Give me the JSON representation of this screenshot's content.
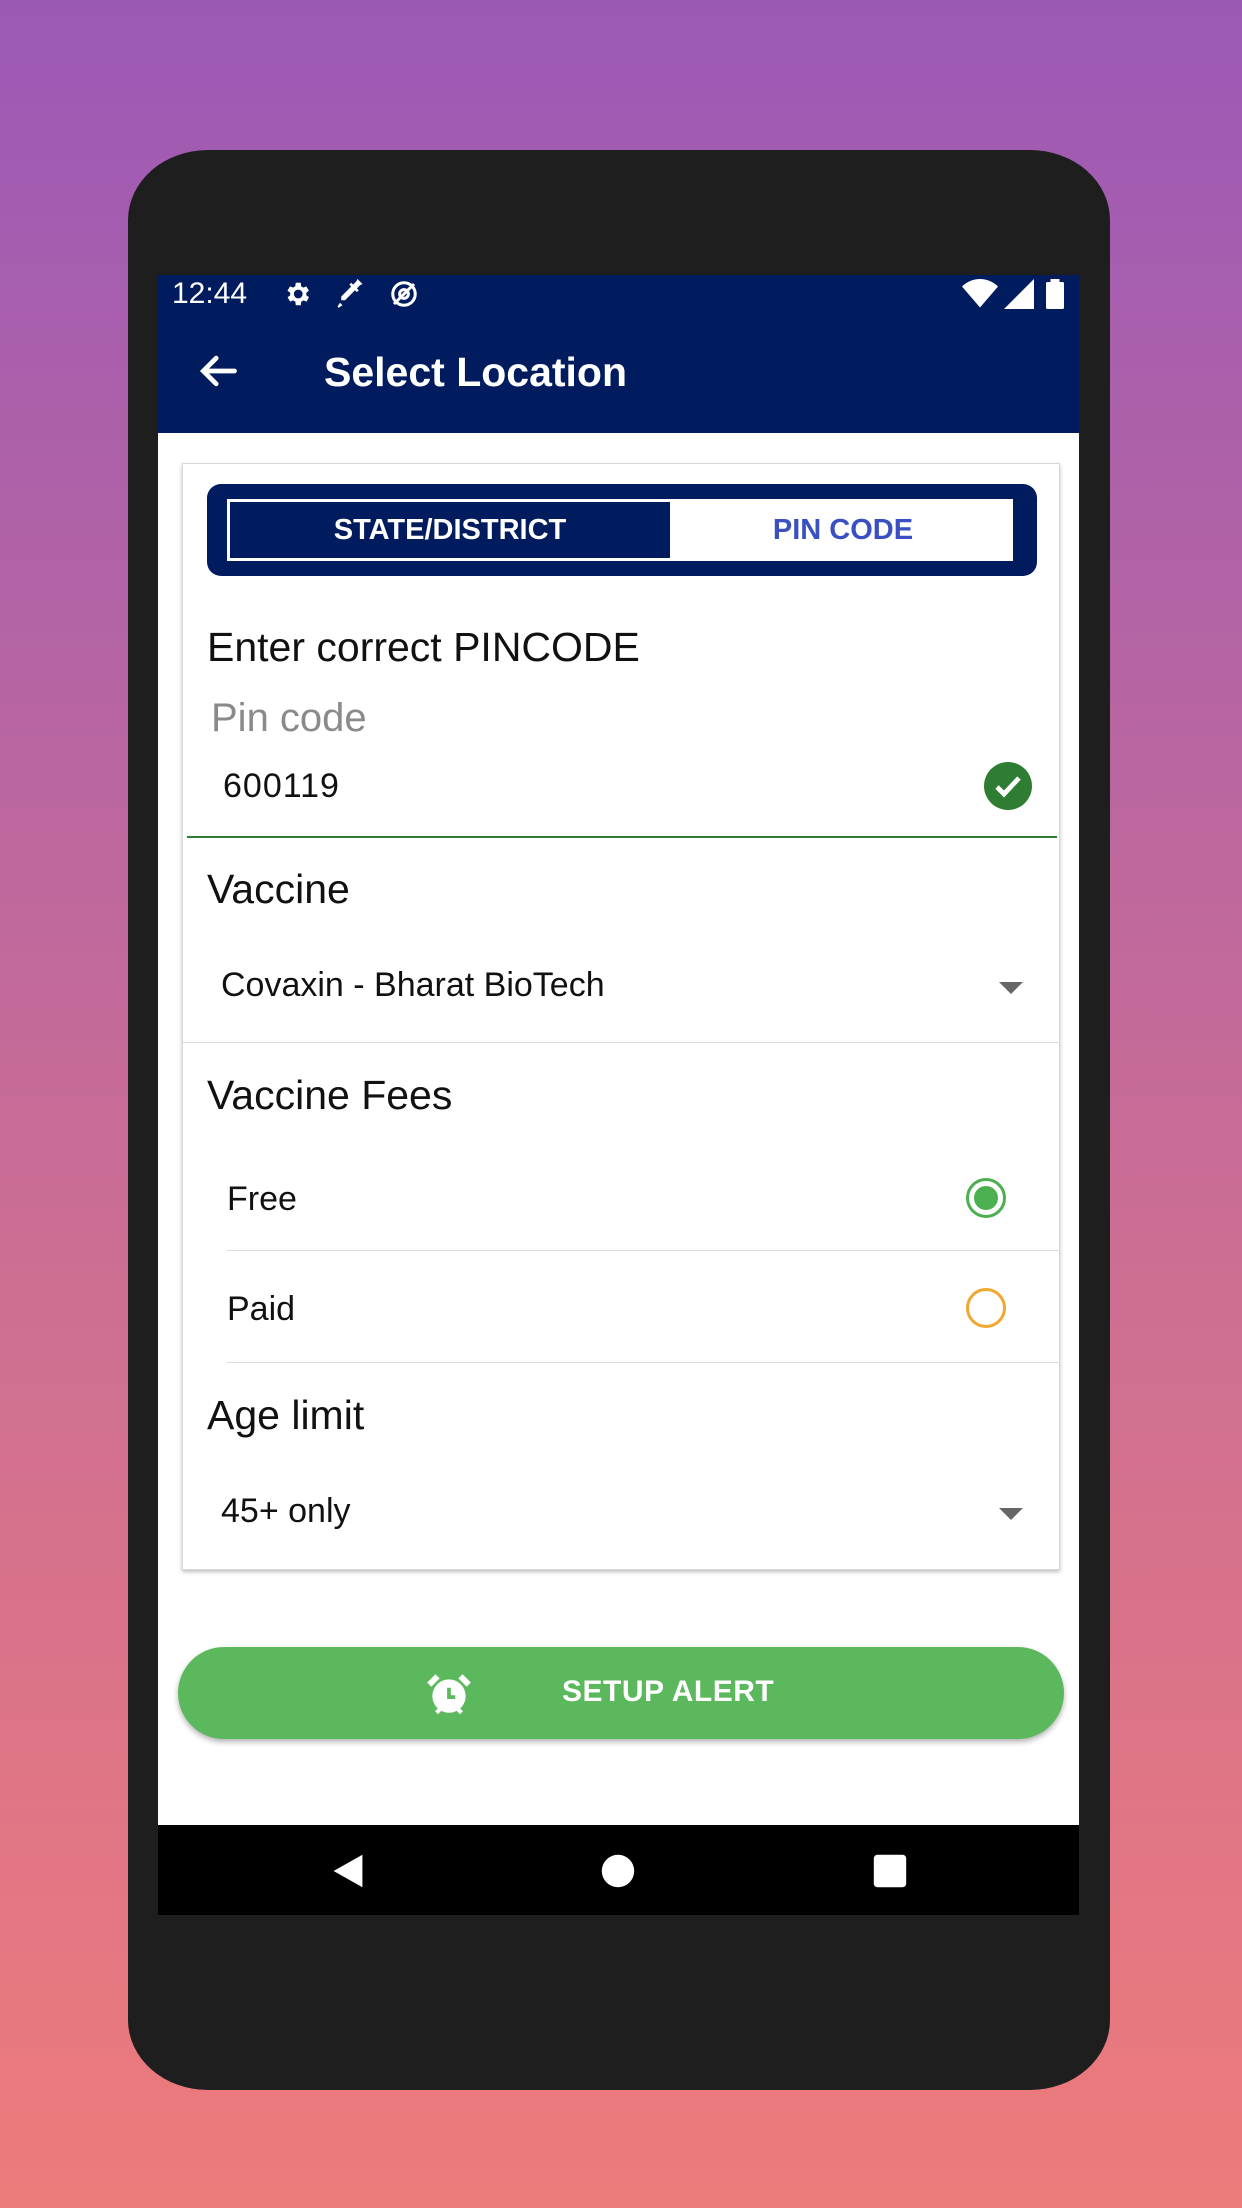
{
  "status_bar": {
    "time": "12:44",
    "icons": [
      "gear-icon",
      "syringe-icon",
      "vpn-icon",
      "wifi-icon",
      "signal-icon",
      "battery-icon"
    ]
  },
  "app_bar": {
    "title": "Select Location",
    "back_icon": "arrow-left-icon",
    "background": "#011c5e"
  },
  "tabs": [
    {
      "label": "STATE/DISTRICT",
      "selected": false
    },
    {
      "label": "PIN CODE",
      "selected": true
    }
  ],
  "pincode": {
    "heading": "Enter correct PINCODE",
    "placeholder": "Pin code",
    "value": "600119",
    "valid": true
  },
  "vaccine": {
    "heading": "Vaccine",
    "selected": "Covaxin - Bharat BioTech"
  },
  "fees": {
    "heading": "Vaccine Fees",
    "options": [
      {
        "label": "Free",
        "selected": true
      },
      {
        "label": "Paid",
        "selected": false
      }
    ]
  },
  "age": {
    "heading": "Age limit",
    "selected": "45+ only"
  },
  "setup_alert": {
    "label": "SETUP ALERT",
    "icon": "alarm-clock-icon",
    "color": "#5cb85c"
  },
  "nav_bar": {
    "icons": [
      "back-triangle-icon",
      "home-circle-icon",
      "recents-square-icon"
    ]
  }
}
